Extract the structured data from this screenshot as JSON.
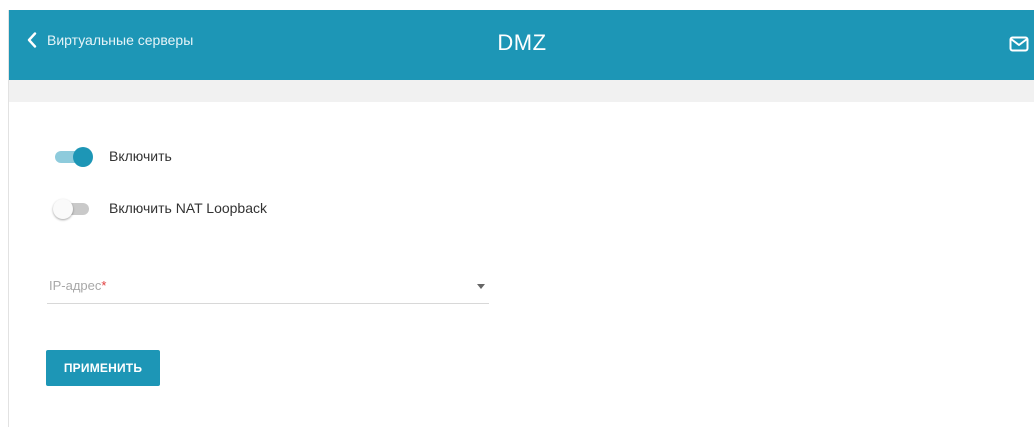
{
  "header": {
    "back_label": "Виртуальные серверы",
    "title": "DMZ",
    "back_icon": "chevron-left-icon",
    "mail_icon": "mail-icon",
    "color": "#1d96b6"
  },
  "form": {
    "enable": {
      "label": "Включить",
      "checked": true
    },
    "nat_loopback": {
      "label": "Включить NAT Loopback",
      "checked": false
    },
    "ip_field": {
      "label": "IP-адрес",
      "required_mark": "*",
      "value": ""
    },
    "apply_label": "ПРИМЕНИТЬ"
  }
}
